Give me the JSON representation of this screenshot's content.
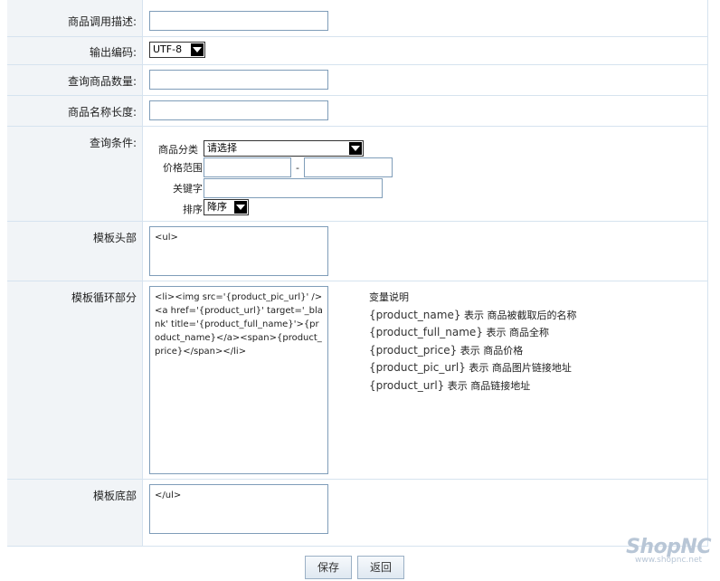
{
  "form": {
    "description_label": "商品调用描述:",
    "description_value": "",
    "encoding_label": "输出编码:",
    "encoding_value": "UTF-8",
    "count_label": "查询商品数量:",
    "count_value": "",
    "name_length_label": "商品名称长度:",
    "name_length_value": "",
    "conditions_label": "查询条件:",
    "category_label": "商品分类",
    "category_value": "请选择",
    "price_range_label": "价格范围",
    "price_min": "",
    "price_separator": "-",
    "price_max": "",
    "keyword_label": "关键字",
    "keyword_value": "",
    "sort_label": "排序",
    "sort_value": "降序",
    "header_label": "模板头部",
    "header_value": "<ul>",
    "loop_label": "模板循环部分",
    "loop_value": "<li><img src='{product_pic_url}' /><a href='{product_url}' target='_blank' title='{product_full_name}'>{product_name}</a><span>{product_price}</span></li>",
    "footer_label": "模板底部",
    "footer_value": "</ul>"
  },
  "variables": {
    "title": "变量说明",
    "items": [
      {
        "code": "{product_name}",
        "desc": "表示 商品被截取后的名称"
      },
      {
        "code": "{product_full_name}",
        "desc": "表示 商品全称"
      },
      {
        "code": "{product_price}",
        "desc": "表示 商品价格"
      },
      {
        "code": "{product_pic_url}",
        "desc": "表示 商品图片链接地址"
      },
      {
        "code": "{product_url}",
        "desc": "表示 商品链接地址"
      }
    ]
  },
  "buttons": {
    "save": "保存",
    "back": "返回"
  },
  "brand": {
    "name": "ShopNC",
    "url": "www.shopnc.net"
  }
}
